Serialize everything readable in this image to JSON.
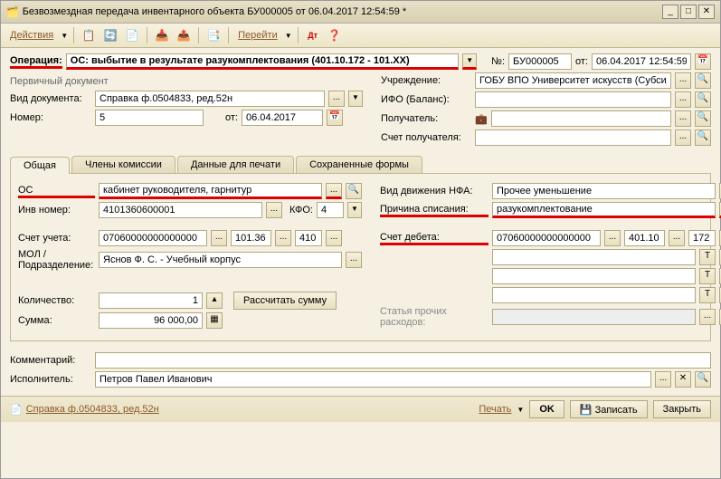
{
  "titlebar": "Безвозмездная передача инвентарного объекта БУ000005 от 06.04.2017 12:54:59 *",
  "toolbar": {
    "actions": "Действия",
    "goto": "Перейти"
  },
  "operation": {
    "label": "Операция:",
    "value": "ОС: выбытие в результате разукомплектования (401.10.172 - 101.ХХ)",
    "num_label": "№:",
    "num": "БУ000005",
    "from_label": "от:",
    "date": "06.04.2017 12:54:59"
  },
  "primary_doc": {
    "title": "Первичный документ",
    "vid_label": "Вид документа:",
    "vid": "Справка ф.0504833, ред.52н",
    "nomer_label": "Номер:",
    "nomer": "5",
    "ot_label": "от:",
    "ot": "06.04.2017"
  },
  "right": {
    "uchr_label": "Учреждение:",
    "uchr": "ГОБУ ВПО Университет искусств (Субсидия)",
    "ifo_label": "ИФО (Баланс):",
    "pol_label": "Получатель:",
    "schet_label": "Счет получателя:"
  },
  "tabs": [
    "Общая",
    "Члены комиссии",
    "Данные для печати",
    "Сохраненные формы"
  ],
  "general": {
    "os_label": "ОС",
    "os": "кабинет руководителя, гарнитур",
    "inv_label": "Инв номер:",
    "inv": "4101360600001",
    "kfo_label": "КФО:",
    "kfo": "4",
    "schet_u_label": "Счет учета:",
    "schet_u1": "07060000000000000",
    "schet_u2": "101.36",
    "schet_u3": "410",
    "mol_label": "МОЛ / Подразделение:",
    "mol": "Яснов Ф. С. - Учебный корпус",
    "kol_label": "Количество:",
    "kol": "1",
    "rass_btn": "Рассчитать сумму",
    "sum_label": "Сумма:",
    "sum": "96 000,00",
    "vid_dv_label": "Вид движения НФА:",
    "vid_dv": "Прочее уменьшение",
    "prich_label": "Причина списания:",
    "prich": "разукомплектование",
    "schet_d_label": "Счет дебета:",
    "schet_d1": "07060000000000000",
    "schet_d2": "401.10",
    "schet_d3": "172",
    "stat_label": "Статья прочих расходов:"
  },
  "bottom": {
    "komm_label": "Комментарий:",
    "isp_label": "Исполнитель:",
    "isp": "Петров Павел Иванович"
  },
  "footer": {
    "left": "Справка ф.0504833, ред.52н",
    "print": "Печать",
    "ok": "OK",
    "save": "Записать",
    "close": "Закрыть"
  }
}
